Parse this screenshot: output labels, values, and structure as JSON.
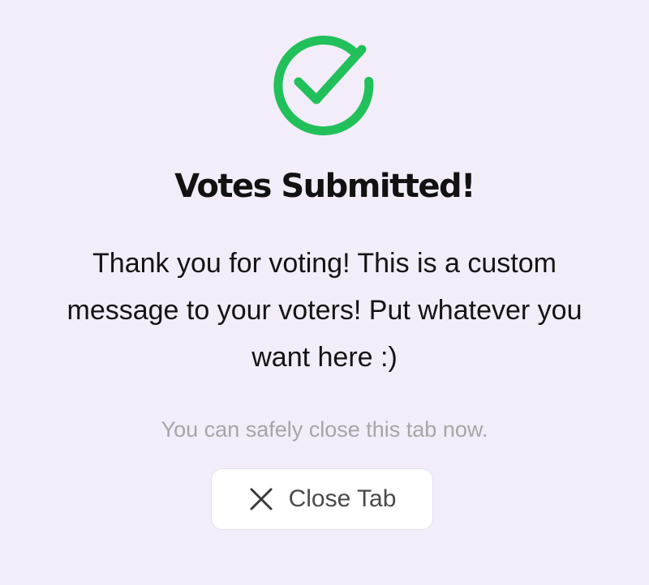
{
  "success": {
    "icon": "check-circle-icon",
    "icon_color": "#22c05a"
  },
  "title": "Votes Submitted!",
  "message": {
    "line1": "Thank you for voting! This is a custom",
    "line2": "message to your voters! Put whatever you",
    "line3": "want here :)"
  },
  "hint": "You can safely close this tab now.",
  "close_button": {
    "icon": "close-icon",
    "label": "Close Tab"
  },
  "colors": {
    "background": "#f2edf9",
    "title": "#121212",
    "hint": "#a6a6a6"
  }
}
